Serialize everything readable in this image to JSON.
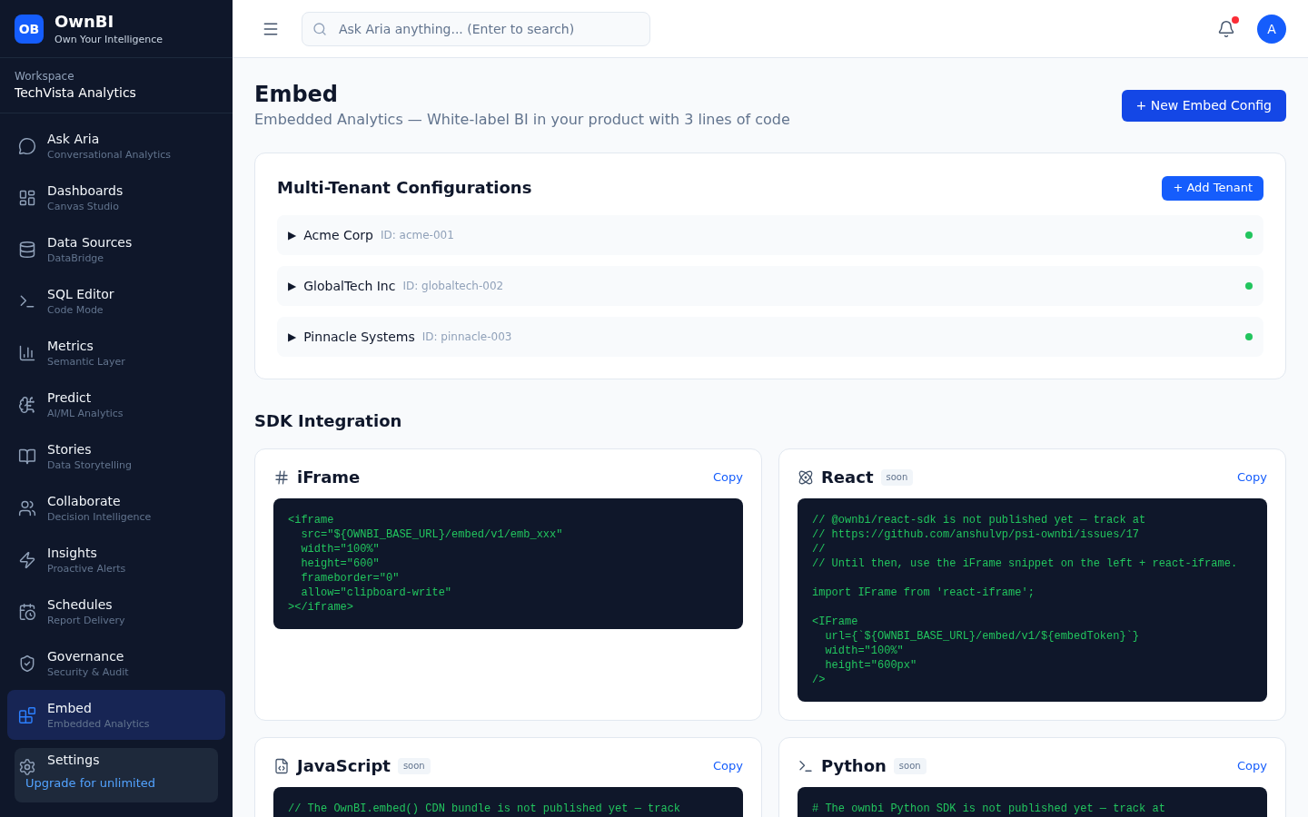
{
  "brand": {
    "logo": "OB",
    "name": "OwnBI",
    "tagline": "Own Your Intelligence"
  },
  "workspace": {
    "label": "Workspace",
    "name": "TechVista Analytics"
  },
  "nav": [
    {
      "label": "Ask Aria",
      "subtitle": "Conversational Analytics",
      "selected": false
    },
    {
      "label": "Dashboards",
      "subtitle": "Canvas Studio",
      "selected": false
    },
    {
      "label": "Data Sources",
      "subtitle": "DataBridge",
      "selected": false
    },
    {
      "label": "SQL Editor",
      "subtitle": "Code Mode",
      "selected": false
    },
    {
      "label": "Metrics",
      "subtitle": "Semantic Layer",
      "selected": false
    },
    {
      "label": "Predict",
      "subtitle": "AI/ML Analytics",
      "selected": false
    },
    {
      "label": "Stories",
      "subtitle": "Data Storytelling",
      "selected": false
    },
    {
      "label": "Collaborate",
      "subtitle": "Decision Intelligence",
      "selected": false
    },
    {
      "label": "Insights",
      "subtitle": "Proactive Alerts",
      "selected": false
    },
    {
      "label": "Schedules",
      "subtitle": "Report Delivery",
      "selected": false
    },
    {
      "label": "Governance",
      "subtitle": "Security & Audit",
      "selected": false
    },
    {
      "label": "Embed",
      "subtitle": "Embedded Analytics",
      "selected": true
    }
  ],
  "nav_footer": {
    "label": "Settings"
  },
  "plan": {
    "link": "Upgrade for unlimited"
  },
  "header": {
    "search": {
      "placeholder": "Ask Aria anything... (Enter to search)"
    },
    "notifications": {
      "unread": true
    },
    "avatar": "A"
  },
  "page": {
    "title": "Embed",
    "subtitle": "Embedded Analytics — White-label BI in your product with 3 lines of code",
    "action": "+ New Embed Config"
  },
  "tenants": {
    "title": "Multi-Tenant Configurations",
    "action": "+ Add Tenant",
    "rows": [
      {
        "marker": "▶",
        "name": "Acme Corp",
        "id": "ID: acme-001",
        "color": "#22c55e"
      },
      {
        "marker": "▶",
        "name": "GlobalTech Inc",
        "id": "ID: globaltech-002",
        "color": "#22c55e"
      },
      {
        "marker": "▶",
        "name": "Pinnacle Systems",
        "id": "ID: pinnacle-003",
        "color": "#22c55e"
      }
    ]
  },
  "sdk": {
    "title": "SDK Integration",
    "cards": [
      {
        "title": "iFrame",
        "copy": "Copy",
        "code": "<iframe\n  src=\"${OWNBI_BASE_URL}/embed/v1/emb_xxx\"\n  width=\"100%\"\n  height=\"600\"\n  frameborder=\"0\"\n  allow=\"clipboard-write\"\n></iframe>"
      },
      {
        "title": "React",
        "badge": "soon",
        "copy": "Copy",
        "code": "// @ownbi/react-sdk is not published yet — track at\n// https://github.com/anshulvp/psi-ownbi/issues/17\n//\n// Until then, use the iFrame snippet on the left + react-iframe.\n\nimport IFrame from 'react-iframe';\n\n<IFrame\n  url={`${OWNBI_BASE_URL}/embed/v1/${embedToken}`}\n  width=\"100%\"\n  height=\"600px\"\n/>"
      },
      {
        "title": "JavaScript",
        "badge": "soon",
        "copy": "Copy",
        "code": "// The OwnBI.embed() CDN bundle is not published yet — track"
      },
      {
        "title": "Python",
        "badge": "soon",
        "copy": "Copy",
        "code": "# The ownbi Python SDK is not published yet — track at"
      }
    ]
  }
}
